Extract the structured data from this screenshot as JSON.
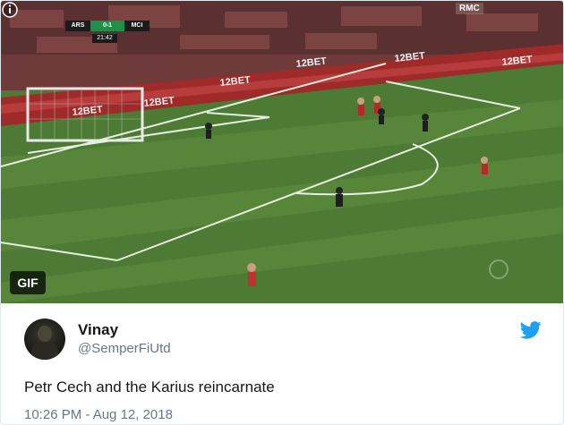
{
  "media": {
    "gif_label": "GIF",
    "scoreboard": {
      "home": "ARS",
      "score": "0-1",
      "away": "MCI",
      "clock": "21:42"
    },
    "watermark": "RMC",
    "adboards": [
      "12BET",
      "12BET",
      "12BET",
      "12BET",
      "12BET",
      "12BET"
    ],
    "icon": "info-icon",
    "colors": {
      "pitch": "#4d7a34",
      "pitch_stripe": "#5a8a3c",
      "crowd": "#7a3b3b"
    }
  },
  "tweet": {
    "name": "Vinay",
    "handle": "@SemperFiUtd",
    "text": "Petr Cech and the Karius reincarnate",
    "timestamp": "10:26 PM - Aug 12, 2018",
    "brand_icon": "twitter-bird-icon",
    "brand_color": "#1da1f2"
  }
}
